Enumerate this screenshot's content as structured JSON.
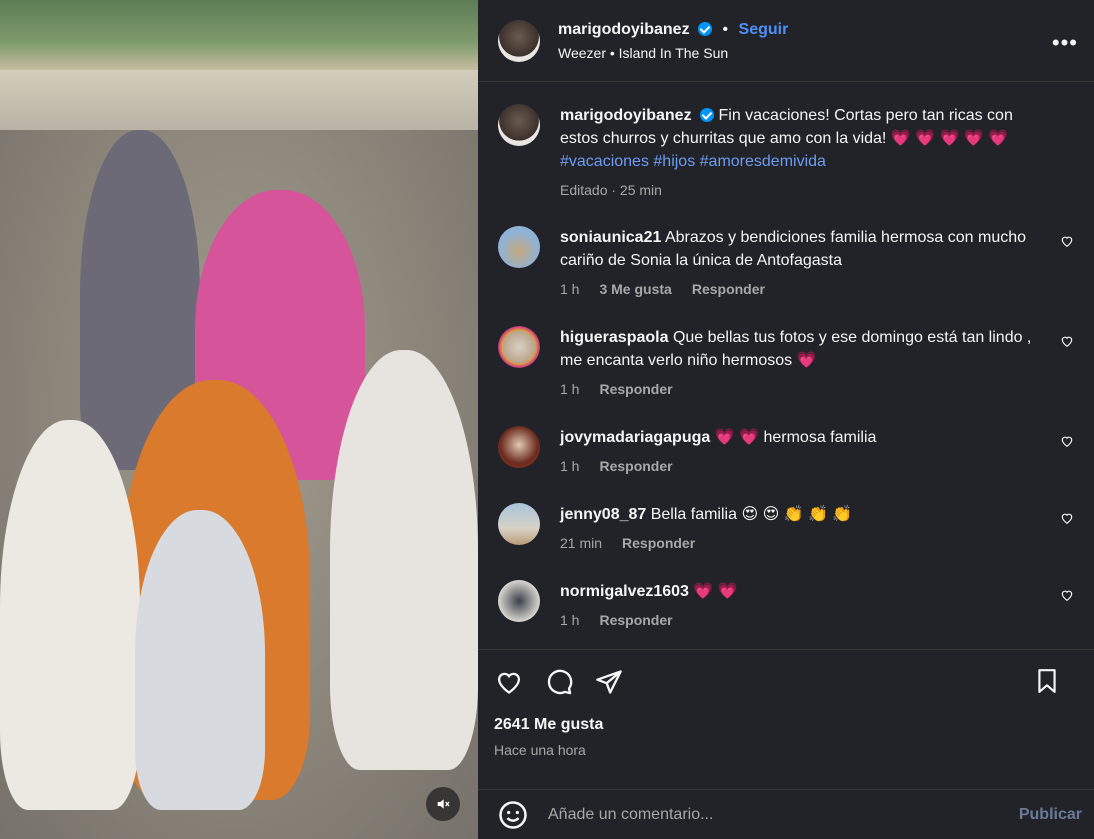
{
  "header": {
    "username": "marigodoyibanez",
    "dot": "•",
    "follow_label": "Seguir",
    "song": "Weezer • Island In The Sun",
    "more_label": "•••"
  },
  "caption": {
    "username": "marigodoyibanez",
    "text": "Fin vacaciones! Cortas pero tan ricas con estos churros y churritas que amo con la vida! ",
    "hearts": "💗 💗 💗 💗 💗",
    "tags": "#vacaciones #hijos #amoresdemivida",
    "meta": "Editado · 25 min"
  },
  "comments": [
    {
      "username": "soniaunica21",
      "text": "Abrazos y bendiciones familia hermosa con mucho cariño de Sonia la única de Antofagasta",
      "time": "1 h",
      "likes": "3 Me gusta",
      "reply": "Responder"
    },
    {
      "username": "higueraspaola",
      "text": "Que bellas tus fotos y ese domingo está tan lindo , me encanta verlo niño hermosos 💗",
      "time": "1 h",
      "reply": "Responder"
    },
    {
      "username": "jovymadariagapuga",
      "text": "💗 💗 hermosa familia",
      "time": "1 h",
      "reply": "Responder"
    },
    {
      "username": "jenny08_87",
      "text": "Bella familia 😍 😍 👏 👏 👏",
      "time": "21 min",
      "reply": "Responder"
    },
    {
      "username": "normigalvez1603",
      "text": "💗 💗",
      "time": "1 h",
      "reply": "Responder"
    }
  ],
  "actions": {
    "likes": "2641 Me gusta",
    "time": "Hace una hora"
  },
  "add_comment": {
    "placeholder": "Añade un comentario...",
    "publish": "Publicar"
  },
  "icons": {
    "like": "heart-icon",
    "comment": "comment-icon",
    "share": "share-icon",
    "save": "bookmark-icon",
    "emoji": "emoji-icon",
    "mute": "muted-speaker-icon"
  },
  "colors": {
    "panel_bg": "#212328",
    "link": "#4f8ff8",
    "hashtag": "#6e9cf2",
    "muted_text": "#a8a8a8",
    "verified": "#0095f6"
  }
}
